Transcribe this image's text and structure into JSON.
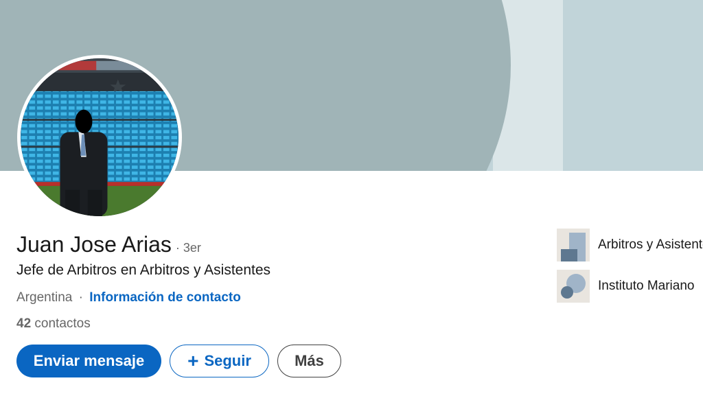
{
  "profile": {
    "name": "Juan Jose Arias",
    "degree": "· 3er",
    "headline": "Jefe de Arbitros en Arbitros y Asistentes",
    "location": "Argentina",
    "location_separator": "·",
    "contact_info_link": "Información de contacto",
    "connections_count": "42",
    "connections_label": "contactos"
  },
  "actions": {
    "message_label": "Enviar mensaje",
    "follow_label": "Seguir",
    "follow_icon": "+",
    "more_label": "Más"
  },
  "sidebar": {
    "items": [
      {
        "label": "Arbitros y Asistentes",
        "icon": "company-logo-icon"
      },
      {
        "label": "Instituto Mariano",
        "icon": "school-logo-icon"
      }
    ]
  },
  "colors": {
    "accent": "#0a66c2",
    "banner": "#a0b4b7",
    "banner_light": "#c1d4d9"
  }
}
